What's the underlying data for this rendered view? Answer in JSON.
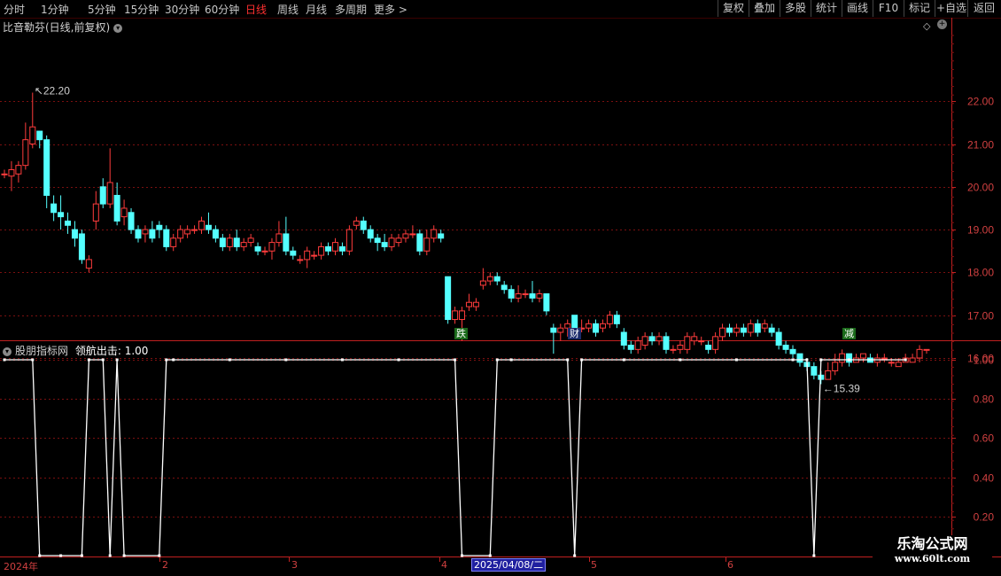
{
  "toolbar": {
    "periods": [
      "分时",
      "1分钟",
      "5分钟",
      "15分钟",
      "30分钟",
      "60分钟",
      "日线",
      "周线",
      "月线",
      "多周期",
      "更多"
    ],
    "active_period": "日线",
    "more_arrow": ">",
    "buttons": [
      "复权",
      "叠加",
      "多股",
      "统计",
      "画线",
      "F10",
      "标记",
      "+自选",
      "返回"
    ]
  },
  "price_panel": {
    "title": "比音勒芬(日线,前复权)",
    "high_label": "22.20",
    "low_label": "15.39",
    "event_badges": [
      {
        "text": "跌",
        "bg": "#1a6a1a",
        "color": "#ffffff"
      },
      {
        "text": "财",
        "bg": "#1a2a6a",
        "color": "#ffffff"
      },
      {
        "text": "减",
        "bg": "#1a6a1a",
        "color": "#ffffff"
      }
    ],
    "y_ticks": [
      "22.00",
      "21.00",
      "20.00",
      "19.00",
      "18.00",
      "17.00",
      "16.00"
    ]
  },
  "indicator_panel": {
    "title": "股朋指标网",
    "series_label": "领航出击",
    "current_value": "1.00",
    "y_ticks": [
      "1.00",
      "0.80",
      "0.60",
      "0.40",
      "0.20"
    ]
  },
  "date_axis": {
    "labels": [
      "2024年",
      "2",
      "3",
      "4",
      "5",
      "6"
    ],
    "cursor_date": "2025/04/08/二"
  },
  "watermark": {
    "title": "乐淘公式网",
    "url": "www.60lt.com"
  },
  "colors": {
    "up": "#ff3c3c",
    "down": "#54ffff",
    "grid": "#7a1010",
    "axis": "#c02020",
    "line": "#ffffff"
  },
  "chart_data": [
    {
      "type": "candlestick",
      "name": "比音勒芬",
      "ylim": [
        15.0,
        22.6
      ],
      "candles": [
        {
          "o": 20.3,
          "c": 20.3,
          "h": 20.4,
          "l": 20.2
        },
        {
          "o": 20.25,
          "c": 20.4,
          "h": 20.6,
          "l": 19.9
        },
        {
          "o": 20.3,
          "c": 20.5,
          "h": 20.6,
          "l": 20.1
        },
        {
          "o": 20.5,
          "c": 21.1,
          "h": 21.5,
          "l": 20.4
        },
        {
          "o": 21.0,
          "c": 21.4,
          "h": 22.2,
          "l": 20.9
        },
        {
          "o": 21.3,
          "c": 21.1,
          "h": 21.3,
          "l": 20.9
        },
        {
          "o": 21.1,
          "c": 19.8,
          "h": 21.2,
          "l": 19.5
        },
        {
          "o": 19.6,
          "c": 19.4,
          "h": 19.8,
          "l": 19.2
        },
        {
          "o": 19.4,
          "c": 19.3,
          "h": 19.8,
          "l": 19.0
        },
        {
          "o": 19.2,
          "c": 19.1,
          "h": 19.4,
          "l": 18.9
        },
        {
          "o": 19.0,
          "c": 18.8,
          "h": 19.2,
          "l": 18.6
        },
        {
          "o": 18.9,
          "c": 18.3,
          "h": 19.0,
          "l": 18.2
        },
        {
          "o": 18.1,
          "c": 18.3,
          "h": 18.4,
          "l": 18.0
        },
        {
          "o": 19.2,
          "c": 19.6,
          "h": 19.9,
          "l": 19.0
        },
        {
          "o": 20.0,
          "c": 19.6,
          "h": 20.2,
          "l": 19.5
        },
        {
          "o": 19.6,
          "c": 20.1,
          "h": 20.9,
          "l": 19.5
        },
        {
          "o": 19.8,
          "c": 19.2,
          "h": 20.1,
          "l": 19.1
        },
        {
          "o": 19.3,
          "c": 19.5,
          "h": 19.7,
          "l": 19.1
        },
        {
          "o": 19.4,
          "c": 19.0,
          "h": 19.5,
          "l": 18.9
        },
        {
          "o": 19.0,
          "c": 18.8,
          "h": 19.1,
          "l": 18.7
        },
        {
          "o": 18.9,
          "c": 19.0,
          "h": 19.1,
          "l": 18.7
        },
        {
          "o": 19.0,
          "c": 18.8,
          "h": 19.2,
          "l": 18.7
        },
        {
          "o": 19.1,
          "c": 19.0,
          "h": 19.2,
          "l": 18.8
        },
        {
          "o": 19.0,
          "c": 18.6,
          "h": 19.1,
          "l": 18.5
        },
        {
          "o": 18.6,
          "c": 18.8,
          "h": 18.9,
          "l": 18.5
        },
        {
          "o": 18.8,
          "c": 19.0,
          "h": 19.1,
          "l": 18.7
        },
        {
          "o": 18.9,
          "c": 19.0,
          "h": 19.1,
          "l": 18.8
        },
        {
          "o": 19.0,
          "c": 19.0,
          "h": 19.1,
          "l": 18.9
        },
        {
          "o": 19.0,
          "c": 19.2,
          "h": 19.3,
          "l": 18.9
        },
        {
          "o": 19.1,
          "c": 19.0,
          "h": 19.4,
          "l": 18.9
        },
        {
          "o": 19.0,
          "c": 18.8,
          "h": 19.1,
          "l": 18.7
        },
        {
          "o": 18.8,
          "c": 18.6,
          "h": 18.9,
          "l": 18.5
        },
        {
          "o": 18.6,
          "c": 18.8,
          "h": 18.9,
          "l": 18.5
        },
        {
          "o": 18.8,
          "c": 18.6,
          "h": 19.0,
          "l": 18.5
        },
        {
          "o": 18.6,
          "c": 18.7,
          "h": 18.8,
          "l": 18.5
        },
        {
          "o": 18.7,
          "c": 18.8,
          "h": 18.9,
          "l": 18.6
        },
        {
          "o": 18.6,
          "c": 18.5,
          "h": 18.7,
          "l": 18.4
        },
        {
          "o": 18.5,
          "c": 18.5,
          "h": 18.6,
          "l": 18.4
        },
        {
          "o": 18.5,
          "c": 18.7,
          "h": 18.8,
          "l": 18.3
        },
        {
          "o": 18.7,
          "c": 18.9,
          "h": 19.2,
          "l": 18.6
        },
        {
          "o": 18.9,
          "c": 18.5,
          "h": 19.3,
          "l": 18.4
        },
        {
          "o": 18.5,
          "c": 18.4,
          "h": 18.6,
          "l": 18.3
        },
        {
          "o": 18.3,
          "c": 18.3,
          "h": 18.4,
          "l": 18.2
        },
        {
          "o": 18.3,
          "c": 18.5,
          "h": 18.6,
          "l": 18.1
        },
        {
          "o": 18.4,
          "c": 18.4,
          "h": 18.5,
          "l": 18.3
        },
        {
          "o": 18.4,
          "c": 18.6,
          "h": 18.7,
          "l": 18.3
        },
        {
          "o": 18.6,
          "c": 18.5,
          "h": 18.7,
          "l": 18.4
        },
        {
          "o": 18.5,
          "c": 18.7,
          "h": 18.8,
          "l": 18.4
        },
        {
          "o": 18.6,
          "c": 18.5,
          "h": 18.7,
          "l": 18.4
        },
        {
          "o": 18.5,
          "c": 19.0,
          "h": 19.1,
          "l": 18.4
        },
        {
          "o": 19.1,
          "c": 19.2,
          "h": 19.3,
          "l": 19.0
        },
        {
          "o": 19.2,
          "c": 19.0,
          "h": 19.3,
          "l": 18.9
        },
        {
          "o": 19.0,
          "c": 18.8,
          "h": 19.1,
          "l": 18.7
        },
        {
          "o": 18.8,
          "c": 18.7,
          "h": 18.9,
          "l": 18.5
        },
        {
          "o": 18.7,
          "c": 18.6,
          "h": 18.9,
          "l": 18.5
        },
        {
          "o": 18.6,
          "c": 18.8,
          "h": 18.9,
          "l": 18.5
        },
        {
          "o": 18.7,
          "c": 18.8,
          "h": 18.9,
          "l": 18.6
        },
        {
          "o": 18.8,
          "c": 18.9,
          "h": 19.0,
          "l": 18.7
        },
        {
          "o": 18.9,
          "c": 18.9,
          "h": 19.1,
          "l": 18.8
        },
        {
          "o": 18.9,
          "c": 18.5,
          "h": 19.0,
          "l": 18.4
        },
        {
          "o": 18.5,
          "c": 18.8,
          "h": 19.0,
          "l": 18.4
        },
        {
          "o": 18.8,
          "c": 19.0,
          "h": 19.1,
          "l": 18.7
        },
        {
          "o": 18.9,
          "c": 18.8,
          "h": 19.0,
          "l": 18.7
        },
        {
          "o": 17.9,
          "c": 16.9,
          "h": 17.9,
          "l": 16.8
        },
        {
          "o": 16.9,
          "c": 17.1,
          "h": 17.2,
          "l": 16.8
        },
        {
          "o": 16.9,
          "c": 17.1,
          "h": 17.2,
          "l": 16.4
        },
        {
          "o": 17.2,
          "c": 17.3,
          "h": 17.5,
          "l": 17.1
        },
        {
          "o": 17.2,
          "c": 17.3,
          "h": 17.4,
          "l": 17.1
        },
        {
          "o": 17.7,
          "c": 17.8,
          "h": 18.1,
          "l": 17.6
        },
        {
          "o": 17.8,
          "c": 17.9,
          "h": 18.0,
          "l": 17.7
        },
        {
          "o": 17.9,
          "c": 17.8,
          "h": 18.0,
          "l": 17.7
        },
        {
          "o": 17.7,
          "c": 17.6,
          "h": 17.8,
          "l": 17.5
        },
        {
          "o": 17.6,
          "c": 17.4,
          "h": 17.7,
          "l": 17.3
        },
        {
          "o": 17.4,
          "c": 17.5,
          "h": 17.7,
          "l": 17.3
        },
        {
          "o": 17.5,
          "c": 17.5,
          "h": 17.6,
          "l": 17.4
        },
        {
          "o": 17.5,
          "c": 17.4,
          "h": 17.8,
          "l": 17.3
        },
        {
          "o": 17.4,
          "c": 17.5,
          "h": 17.6,
          "l": 17.3
        },
        {
          "o": 17.5,
          "c": 17.1,
          "h": 17.5,
          "l": 17.0
        },
        {
          "o": 16.7,
          "c": 16.6,
          "h": 16.8,
          "l": 16.1
        },
        {
          "o": 16.6,
          "c": 16.7,
          "h": 16.8,
          "l": 16.4
        },
        {
          "o": 16.7,
          "c": 16.8,
          "h": 16.9,
          "l": 16.5
        },
        {
          "o": 17.0,
          "c": 16.7,
          "h": 17.0,
          "l": 16.6
        },
        {
          "o": 16.7,
          "c": 16.7,
          "h": 16.9,
          "l": 16.6
        },
        {
          "o": 16.7,
          "c": 16.8,
          "h": 16.9,
          "l": 16.6
        },
        {
          "o": 16.8,
          "c": 16.6,
          "h": 16.9,
          "l": 16.5
        },
        {
          "o": 16.7,
          "c": 16.8,
          "h": 16.9,
          "l": 16.6
        },
        {
          "o": 16.8,
          "c": 17.0,
          "h": 17.1,
          "l": 16.7
        },
        {
          "o": 17.0,
          "c": 16.8,
          "h": 17.1,
          "l": 16.7
        },
        {
          "o": 16.6,
          "c": 16.3,
          "h": 16.7,
          "l": 16.2
        },
        {
          "o": 16.3,
          "c": 16.2,
          "h": 16.4,
          "l": 16.1
        },
        {
          "o": 16.2,
          "c": 16.4,
          "h": 16.5,
          "l": 16.1
        },
        {
          "o": 16.3,
          "c": 16.5,
          "h": 16.6,
          "l": 16.2
        },
        {
          "o": 16.5,
          "c": 16.4,
          "h": 16.6,
          "l": 16.3
        },
        {
          "o": 16.4,
          "c": 16.5,
          "h": 16.6,
          "l": 16.3
        },
        {
          "o": 16.5,
          "c": 16.2,
          "h": 16.6,
          "l": 16.1
        },
        {
          "o": 16.2,
          "c": 16.2,
          "h": 16.3,
          "l": 16.1
        },
        {
          "o": 16.2,
          "c": 16.3,
          "h": 16.4,
          "l": 16.1
        },
        {
          "o": 16.2,
          "c": 16.5,
          "h": 16.6,
          "l": 16.1
        },
        {
          "o": 16.4,
          "c": 16.5,
          "h": 16.6,
          "l": 16.3
        },
        {
          "o": 16.4,
          "c": 16.4,
          "h": 16.5,
          "l": 16.3
        },
        {
          "o": 16.3,
          "c": 16.2,
          "h": 16.4,
          "l": 16.1
        },
        {
          "o": 16.2,
          "c": 16.5,
          "h": 16.6,
          "l": 16.1
        },
        {
          "o": 16.5,
          "c": 16.7,
          "h": 16.8,
          "l": 16.4
        },
        {
          "o": 16.7,
          "c": 16.6,
          "h": 16.8,
          "l": 16.5
        },
        {
          "o": 16.6,
          "c": 16.7,
          "h": 16.8,
          "l": 16.5
        },
        {
          "o": 16.7,
          "c": 16.6,
          "h": 16.8,
          "l": 16.5
        },
        {
          "o": 16.6,
          "c": 16.8,
          "h": 16.9,
          "l": 16.5
        },
        {
          "o": 16.8,
          "c": 16.6,
          "h": 16.9,
          "l": 16.5
        },
        {
          "o": 16.7,
          "c": 16.8,
          "h": 16.9,
          "l": 16.6
        },
        {
          "o": 16.7,
          "c": 16.6,
          "h": 16.8,
          "l": 16.5
        },
        {
          "o": 16.6,
          "c": 16.3,
          "h": 16.7,
          "l": 16.2
        },
        {
          "o": 16.3,
          "c": 16.2,
          "h": 16.4,
          "l": 16.1
        },
        {
          "o": 16.2,
          "c": 16.1,
          "h": 16.3,
          "l": 16.0
        },
        {
          "o": 16.1,
          "c": 15.9,
          "h": 16.1,
          "l": 15.8
        },
        {
          "o": 15.9,
          "c": 15.8,
          "h": 16.0,
          "l": 15.7
        },
        {
          "o": 15.8,
          "c": 15.6,
          "h": 15.9,
          "l": 15.5
        },
        {
          "o": 15.6,
          "c": 15.5,
          "h": 15.7,
          "l": 15.39
        },
        {
          "o": 15.5,
          "c": 15.7,
          "h": 15.9,
          "l": 15.5
        },
        {
          "o": 15.7,
          "c": 15.9,
          "h": 16.1,
          "l": 15.6
        },
        {
          "o": 15.9,
          "c": 16.1,
          "h": 16.2,
          "l": 15.8
        },
        {
          "o": 16.1,
          "c": 15.9,
          "h": 16.1,
          "l": 15.8
        },
        {
          "o": 15.9,
          "c": 16.0,
          "h": 16.1,
          "l": 15.9
        },
        {
          "o": 16.0,
          "c": 16.1,
          "h": 16.1,
          "l": 15.9
        },
        {
          "o": 16.0,
          "c": 15.9,
          "h": 16.1,
          "l": 15.9
        },
        {
          "o": 15.9,
          "c": 16.0,
          "h": 16.1,
          "l": 15.8
        },
        {
          "o": 16.0,
          "c": 16.0,
          "h": 16.1,
          "l": 15.9
        },
        {
          "o": 15.9,
          "c": 15.9,
          "h": 16.0,
          "l": 15.8
        },
        {
          "o": 15.8,
          "c": 15.9,
          "h": 16.0,
          "l": 15.8
        },
        {
          "o": 15.9,
          "c": 16.0,
          "h": 16.1,
          "l": 15.9
        },
        {
          "o": 15.9,
          "c": 16.0,
          "h": 16.1,
          "l": 15.9
        },
        {
          "o": 16.0,
          "c": 16.2,
          "h": 16.3,
          "l": 15.9
        },
        {
          "o": 16.2,
          "c": 16.2,
          "h": 16.2,
          "l": 16.1
        }
      ]
    },
    {
      "type": "line",
      "name": "领航出击",
      "ylim": [
        0.0,
        1.05
      ],
      "values": [
        1,
        1,
        1,
        1,
        1,
        0,
        0,
        0,
        0,
        0,
        0,
        0,
        1,
        1,
        1,
        0,
        1,
        0,
        0,
        0,
        0,
        0,
        0,
        1,
        1,
        1,
        1,
        1,
        1,
        1,
        1,
        1,
        1,
        1,
        1,
        1,
        1,
        1,
        1,
        1,
        1,
        1,
        1,
        1,
        1,
        1,
        1,
        1,
        1,
        1,
        1,
        1,
        1,
        1,
        1,
        1,
        1,
        1,
        1,
        1,
        1,
        1,
        1,
        1,
        1,
        0,
        0,
        0,
        0,
        0,
        1,
        1,
        1,
        1,
        1,
        1,
        1,
        1,
        1,
        1,
        1,
        0,
        1,
        1,
        1,
        1,
        1,
        1,
        1,
        1,
        1,
        1,
        1,
        1,
        1,
        1,
        1,
        1,
        1,
        1,
        1,
        1,
        1,
        1,
        1,
        1,
        1,
        1,
        1,
        1,
        1,
        1,
        1,
        1,
        1,
        0,
        1,
        1,
        1,
        1,
        1,
        1,
        1,
        1,
        1,
        1,
        1,
        1,
        1
      ]
    }
  ]
}
